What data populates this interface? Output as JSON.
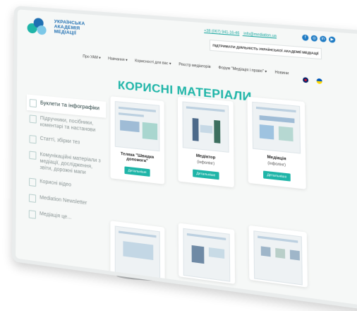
{
  "header": {
    "brand_lines": [
      "УКРАЇНСЬКА",
      "АКАДЕМІЯ",
      "МЕДІАЦІЇ"
    ],
    "phone": "+38 (067) 941-16-46",
    "email": "info@mediation.ua",
    "support_button": "ПІДТРИМАТИ ДІЯЛЬНІСТЬ УКРАЇНСЬКОЇ АКАДЕМІЇ МЕДІАЦІЇ",
    "social_icons": [
      "facebook-icon",
      "instagram-icon",
      "linkedin-icon",
      "youtube-icon"
    ]
  },
  "nav": {
    "items": [
      "Про УАМ ▾",
      "Навчання ▾",
      "Корисності для вас ▾",
      "Реєстр медіаторів",
      "Форум \"Медіація і право\" ▾",
      "Новини"
    ]
  },
  "flags": [
    "uk-flag-icon",
    "ua-flag-icon"
  ],
  "page": {
    "title": "КОРИСНІ МАТЕРІАЛИ"
  },
  "sidebar": {
    "items": [
      {
        "label": "Буклети та інфографіки",
        "active": true
      },
      {
        "label": "Підручники, посібники, коментарі та настанови",
        "active": false
      },
      {
        "label": "Статті, збірки тез",
        "active": false
      },
      {
        "label": "Комунікаційні матеріали з медіації, дослідження, звіти, дорожні мапи",
        "active": false
      },
      {
        "label": "Корисні відео",
        "active": false
      },
      {
        "label": "Mediation Newsletter",
        "active": false
      },
      {
        "label": "Медіація це...",
        "active": false
      }
    ]
  },
  "cards": [
    {
      "title": "Теляка \"Швидка допомога\"",
      "subtitle": "",
      "button": "Детальніше"
    },
    {
      "title": "Медіатор",
      "subtitle": "(інфолінг)",
      "button": "Детальніше"
    },
    {
      "title": "Медіація",
      "subtitle": "(інфолінг)",
      "button": "Детальніше"
    },
    {
      "title": "",
      "subtitle": "",
      "button": ""
    },
    {
      "title": "",
      "subtitle": "",
      "button": ""
    },
    {
      "title": "",
      "subtitle": "",
      "button": ""
    }
  ],
  "colors": {
    "accent": "#1fb5a8",
    "brand_blue": "#1f6fb2"
  }
}
